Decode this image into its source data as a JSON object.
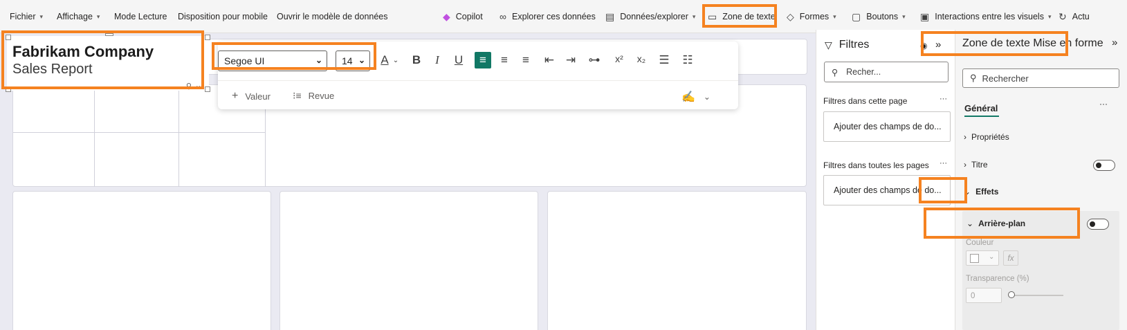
{
  "ribbon": {
    "items": [
      {
        "label": "Fichier",
        "has_chevron": true
      },
      {
        "label": "Affichage",
        "has_chevron": true
      },
      {
        "label": "Mode Lecture",
        "has_chevron": false
      },
      {
        "label": "Disposition pour mobile",
        "has_chevron": false
      },
      {
        "label": "Ouvrir le modèle de données",
        "has_chevron": false
      }
    ],
    "right_items": [
      {
        "label": "Copilot",
        "icon": "copilot-icon"
      },
      {
        "label": "Explorer ces données",
        "icon": "binoculars-icon"
      },
      {
        "label": "Données/explorer",
        "icon": "data-icon",
        "has_chevron": true
      },
      {
        "label": "Zone de texte",
        "icon": "textbox-icon",
        "highlighted": true
      },
      {
        "label": "Formes",
        "icon": "shapes-icon",
        "has_chevron": true
      },
      {
        "label": "Boutons",
        "icon": "buttons-icon",
        "has_chevron": true
      },
      {
        "label": "Interactions entre les visuels",
        "icon": "interactions-icon",
        "has_chevron": true
      },
      {
        "label": "Actu",
        "icon": "refresh-icon"
      }
    ]
  },
  "textbox": {
    "title": "Fabrikam Company",
    "subtitle": "Sales Report"
  },
  "format_toolbar": {
    "font_family": "Segoe UI",
    "font_size": "14",
    "bottom": {
      "value_label": "Valeur",
      "review_label": "Revue"
    }
  },
  "filters": {
    "title": "Filtres",
    "search_placeholder": "Recher...",
    "this_page_label": "Filtres dans cette page",
    "all_pages_label": "Filtres dans toutes les pages",
    "add_fields_label": "Ajouter des champs de do..."
  },
  "format_pane": {
    "title": "Zone de texte Mise en forme",
    "search_placeholder": "Rechercher",
    "tab_general": "Général",
    "properties_label": "Propriétés",
    "title_label": "Titre",
    "effects_label": "Effets",
    "background_label": "Arrière-plan",
    "color_label": "Couleur",
    "transparency_label": "Transparence (%)",
    "transparency_value": "0"
  },
  "colors": {
    "accent": "#117865",
    "highlight": "#f58220"
  }
}
